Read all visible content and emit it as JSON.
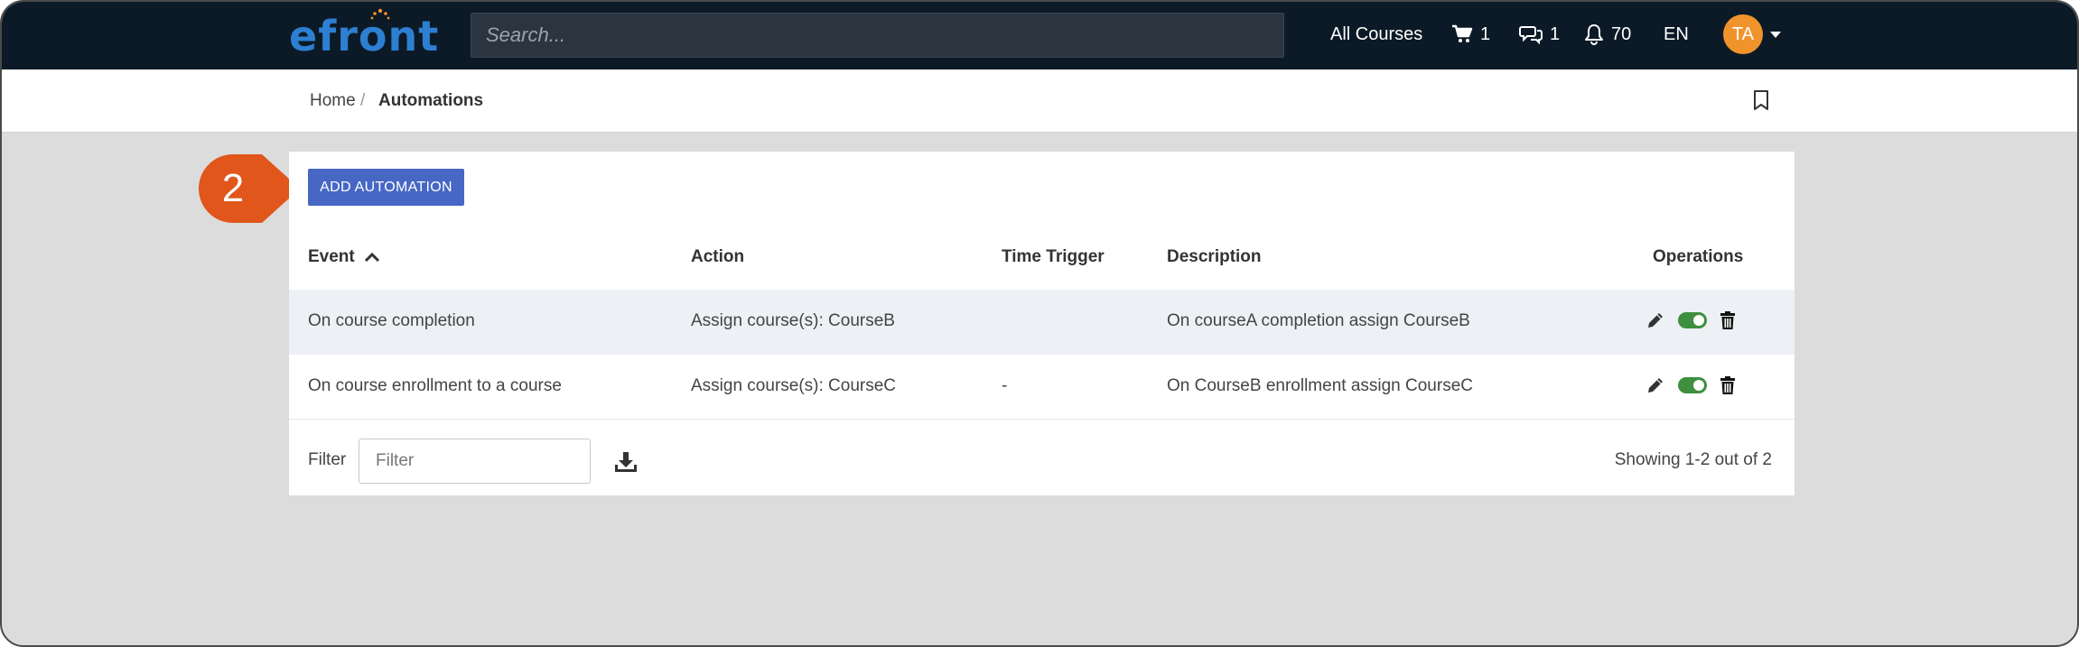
{
  "topbar": {
    "logo_text": "efront",
    "search_placeholder": "Search...",
    "all_courses_label": "All Courses",
    "cart_count": "1",
    "messages_count": "1",
    "notifications_count": "70",
    "language": "EN",
    "avatar_initials": "TA"
  },
  "breadcrumb": {
    "home": "Home",
    "separator": "/",
    "current": "Automations"
  },
  "toolbar": {
    "add_automation_label": "ADD AUTOMATION"
  },
  "step_marker": {
    "number": "2",
    "color": "#e0561b"
  },
  "table": {
    "headers": {
      "event": "Event",
      "action": "Action",
      "time_trigger": "Time Trigger",
      "description": "Description",
      "operations": "Operations"
    },
    "rows": [
      {
        "event": "On course completion",
        "action": "Assign course(s): CourseB",
        "time_trigger": "",
        "description": "On courseA completion assign CourseB",
        "enabled": true
      },
      {
        "event": "On course enrollment to a course",
        "action": "Assign course(s): CourseC",
        "time_trigger": "-",
        "description": "On CourseB enrollment assign CourseC",
        "enabled": true
      }
    ]
  },
  "footer": {
    "filter_label": "Filter",
    "filter_placeholder": "Filter",
    "showing": "Showing 1-2 out of 2"
  },
  "colors": {
    "topbar": "#0b1a26",
    "primary_button": "#4767c5",
    "toggle_on": "#3e8f3e",
    "avatar": "#f0932b"
  }
}
